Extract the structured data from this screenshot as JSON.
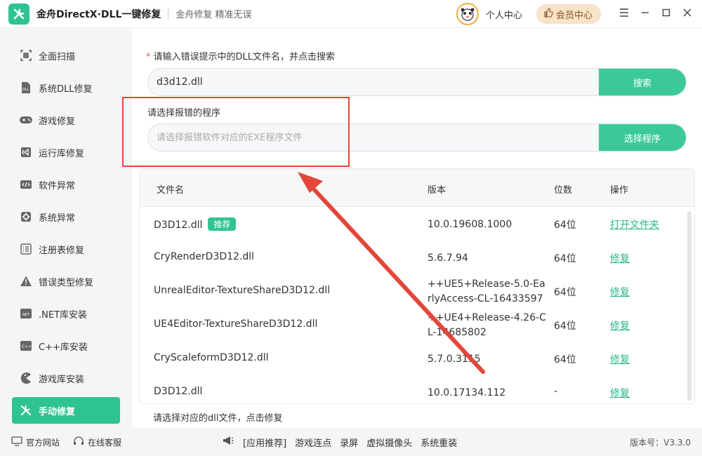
{
  "titlebar": {
    "app_title": "金舟DirectX·DLL一键修复",
    "slogan": "金舟修复 精准无误",
    "user_center": "个人中心",
    "vip": "会员中心"
  },
  "sidebar": {
    "items": [
      {
        "label": "全面扫描",
        "icon": "scan-icon"
      },
      {
        "label": "系统DLL修复",
        "icon": "dll-icon"
      },
      {
        "label": "游戏修复",
        "icon": "gamepad-icon"
      },
      {
        "label": "运行库修复",
        "icon": "visual-studio-icon"
      },
      {
        "label": "软件异常",
        "icon": "code-icon"
      },
      {
        "label": "系统异常",
        "icon": "gear-icon"
      },
      {
        "label": "注册表修复",
        "icon": "list-icon"
      },
      {
        "label": "错误类型修复",
        "icon": "warning-icon"
      },
      {
        "label": ".NET库安装",
        "icon": "dotnet-icon"
      },
      {
        "label": "C++库安装",
        "icon": "cpp-icon"
      },
      {
        "label": "游戏库安装",
        "icon": "pacman-icon"
      },
      {
        "label": "手动修复",
        "icon": "tools-icon",
        "active": true
      }
    ]
  },
  "main": {
    "dll_label_star": "*",
    "dll_label": "请输入错误提示中的DLL文件名，并点击搜索",
    "dll_value": "d3d12.dll",
    "search_button": "搜索",
    "program_label": "请选择报错的程序",
    "program_placeholder": "请选择报错软件对应的EXE程序文件",
    "select_program_button": "选择程序",
    "table": {
      "headers": {
        "name": "文件名",
        "version": "版本",
        "bits": "位数",
        "action": "操作"
      },
      "recommend_badge": "推荐",
      "rows": [
        {
          "name": "D3D12.dll",
          "version": "10.0.19608.1000",
          "bits": "64位",
          "action": "打开文件夹",
          "recommended": true
        },
        {
          "name": "CryRenderD3D12.dll",
          "version": "5.6.7.94",
          "bits": "64位",
          "action": "修复"
        },
        {
          "name": "UnrealEditor-TextureShareD3D12.dll",
          "version_line1": "++UE5+Release-5.0-Ea",
          "version_line2": "rlyAccess-CL-16433597",
          "bits": "64位",
          "action": "修复"
        },
        {
          "name": "UE4Editor-TextureShareD3D12.dll",
          "version_line1": "++UE4+Release-4.26-C",
          "version_line2": "L-14685802",
          "bits": "64位",
          "action": "修复"
        },
        {
          "name": "CryScaleformD3D12.dll",
          "version": "5.7.0.3115",
          "bits": "64位",
          "action": "修复"
        },
        {
          "name": "D3D12.dll",
          "version": "10.0.17134.112",
          "bits": "-",
          "action": "修复"
        }
      ]
    },
    "hint": "请选择对应的dll文件，点击修复"
  },
  "bottombar": {
    "website": "官方网站",
    "service": "在线客服",
    "links": [
      "[应用推荐]",
      "游戏连点",
      "录屏",
      "虚拟摄像头",
      "系统重装"
    ],
    "version": "版本号：V3.3.0"
  },
  "colors": {
    "accent": "#2fc48f",
    "highlight": "#e4463a",
    "link": "#2bb885"
  }
}
